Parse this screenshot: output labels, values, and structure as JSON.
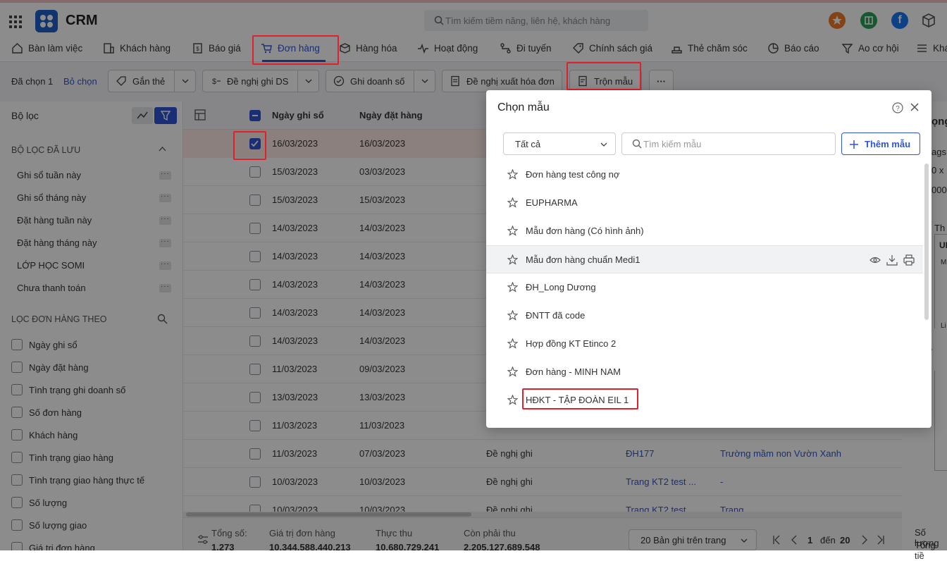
{
  "app": {
    "name": "CRM"
  },
  "search": {
    "placeholder": "Tìm kiếm tiềm năng, liên hệ, khách hàng"
  },
  "nav": {
    "items": [
      {
        "label": "Bàn làm việc"
      },
      {
        "label": "Khách hàng"
      },
      {
        "label": "Báo giá"
      },
      {
        "label": "Đơn hàng"
      },
      {
        "label": "Hàng hóa"
      },
      {
        "label": "Hoạt động"
      },
      {
        "label": "Đi tuyến"
      },
      {
        "label": "Chính sách giá"
      },
      {
        "label": "Thẻ chăm sóc"
      },
      {
        "label": "Báo cáo"
      },
      {
        "label": "Ao cơ hội"
      },
      {
        "label": "Khá"
      }
    ],
    "active_index": 3
  },
  "toolbar": {
    "selected_count": "Đã chọn 1",
    "deselect": "Bỏ chọn",
    "tag": "Gắn thẻ",
    "propose_ds": "Đề nghị ghi DS",
    "record_sales": "Ghi doanh số",
    "propose_invoice": "Đề nghị xuất hóa đơn",
    "merge_template": "Trộn mẫu",
    "more": "···"
  },
  "sidebar": {
    "filter_title": "Bộ lọc",
    "saved_title": "BỘ LỌC ĐÃ LƯU",
    "saved": [
      "Ghi sổ tuần này",
      "Ghi sổ tháng này",
      "Đặt hàng tuần này",
      "Đặt hàng tháng này",
      "LỚP HỌC SOMI",
      "Chưa thanh toán"
    ],
    "filter_by_title": "LỌC ĐƠN HÀNG THEO",
    "filter_by": [
      "Ngày ghi sổ",
      "Ngày đặt hàng",
      "Tình trạng ghi doanh số",
      "Số đơn hàng",
      "Khách hàng",
      "Tình trạng giao hàng",
      "Tình trạng giao hàng thực tế",
      "Số lượng",
      "Số lượng giao",
      "Giá trị đơn hàng"
    ]
  },
  "grid": {
    "headers": {
      "book_date": "Ngày ghi sổ",
      "order_date": "Ngày đặt hàng"
    },
    "rows": [
      {
        "book": "16/03/2023",
        "order": "16/03/2023",
        "status": "",
        "code": "",
        "customer": "",
        "checked": true
      },
      {
        "book": "15/03/2023",
        "order": "03/03/2023",
        "status": "",
        "code": "",
        "customer": ""
      },
      {
        "book": "15/03/2023",
        "order": "15/03/2023",
        "status": "",
        "code": "",
        "customer": ""
      },
      {
        "book": "14/03/2023",
        "order": "14/03/2023",
        "status": "",
        "code": "",
        "customer": ""
      },
      {
        "book": "14/03/2023",
        "order": "14/03/2023",
        "status": "",
        "code": "",
        "customer": ""
      },
      {
        "book": "14/03/2023",
        "order": "14/03/2023",
        "status": "",
        "code": "",
        "customer": ""
      },
      {
        "book": "14/03/2023",
        "order": "14/03/2023",
        "status": "",
        "code": "",
        "customer": ""
      },
      {
        "book": "14/03/2023",
        "order": "14/03/2023",
        "status": "",
        "code": "",
        "customer": ""
      },
      {
        "book": "11/03/2023",
        "order": "09/03/2023",
        "status": "",
        "code": "",
        "customer": ""
      },
      {
        "book": "13/03/2023",
        "order": "13/03/2023",
        "status": "",
        "code": "",
        "customer": ""
      },
      {
        "book": "11/03/2023",
        "order": "11/03/2023",
        "status": "",
        "code": "",
        "customer": ""
      },
      {
        "book": "11/03/2023",
        "order": "07/03/2023",
        "status": "Đề nghị ghi",
        "code": "ĐH177",
        "customer": "Trường mầm non Vườn Xanh"
      },
      {
        "book": "10/03/2023",
        "order": "10/03/2023",
        "status": "Đề nghị ghi",
        "code": "Trang KT2 test ...",
        "customer": "-"
      },
      {
        "book": "10/03/2023",
        "order": "10/03/2023",
        "status": "Đề nghị ghi",
        "code": "Trang KT2 test",
        "customer": "Trang"
      }
    ]
  },
  "footer": {
    "total_label": "Tổng số:",
    "total": "1.273",
    "order_value_label": "Giá trị đơn hàng",
    "order_value": "10.344.588.440.213",
    "collected_label": "Thực thu",
    "collected": "10.680.729.241",
    "remaining_label": "Còn phải thu",
    "remaining": "2.205.127.689.548",
    "page_size": "20 Bản ghi trên trang",
    "page_from": "1",
    "page_to_label": "đến",
    "page_to": "20"
  },
  "right_panel": {
    "l1": "ọng",
    "l2": "ags",
    "l3": "0 x",
    "l4": "000",
    "l5": "Th",
    "l6": "UI",
    "l7": "M",
    "l8": "Li",
    "l9": "Số lượng",
    "l10": "Tổng tiề"
  },
  "modal": {
    "title": "Chọn mẫu",
    "filter_value": "Tất cả",
    "search_placeholder": "Tìm kiếm mẫu",
    "add_button": "Thêm mẫu",
    "templates": [
      "Đơn hàng test công nợ",
      "EUPHARMA",
      "Mẫu đơn hàng (Có hình ảnh)",
      "Mẫu đơn hàng chuẩn Medi1",
      "ĐH_Long Dương",
      "ĐNTT đã code",
      "Hợp đồng KT Etinco 2",
      "Đơn hàng - MINH NAM",
      "HĐKT - TẬP ĐOÀN EIL 1"
    ],
    "hovered_index": 3
  },
  "colors": {
    "primary": "#2f55d4",
    "highlight": "#e0202a"
  }
}
